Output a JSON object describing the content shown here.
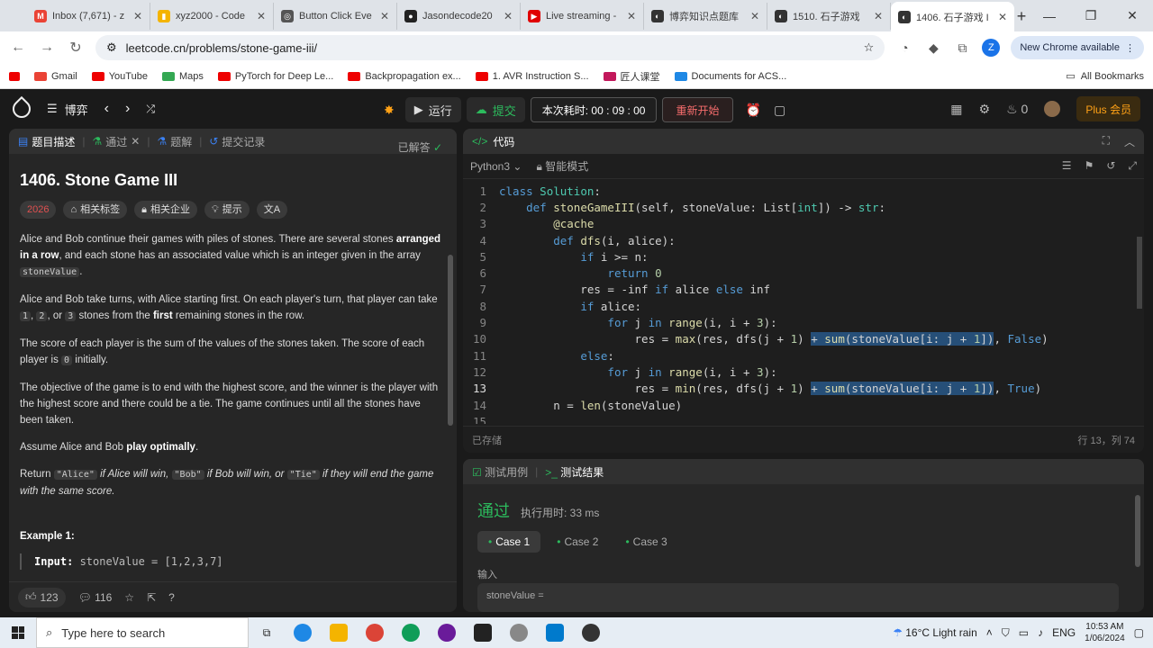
{
  "browser": {
    "tabs": [
      {
        "title": "Inbox (7,671) - z",
        "color": "#ea4335",
        "glyph": "M"
      },
      {
        "title": "xyz2000 - Code",
        "color": "#f4b400",
        "glyph": "▮"
      },
      {
        "title": "Button Click Eve",
        "color": "#555555",
        "glyph": "◎"
      },
      {
        "title": "Jasondecode20",
        "color": "#222222",
        "glyph": "●"
      },
      {
        "title": "Live streaming -",
        "color": "#e00000",
        "glyph": "▶"
      },
      {
        "title": "博弈知识点题库",
        "color": "#333333",
        "glyph": "◐"
      },
      {
        "title": "1510. 石子游戏",
        "color": "#333333",
        "glyph": "◐"
      },
      {
        "title": "1406. 石子游戏 I",
        "color": "#333333",
        "glyph": "◐"
      }
    ],
    "url": "leetcode.cn/problems/stone-game-iii/",
    "new_chrome": "New Chrome available",
    "profile_initial": "Z",
    "bookmarks": [
      "Gmail",
      "YouTube",
      "Maps",
      "PyTorch for Deep Le...",
      "Backpropagation ex...",
      "1. AVR Instruction S...",
      "匠人课堂",
      "Documents for ACS..."
    ],
    "all_bookmarks": "All Bookmarks"
  },
  "lc_header": {
    "problem_list": "博弈",
    "run": "运行",
    "submit": "提交",
    "timer": "本次耗时: 00 : 09 : 00",
    "restart": "重新开始",
    "streak": "0",
    "plus": "Plus 会员"
  },
  "left": {
    "tabs": [
      "题目描述",
      "通过",
      "题解",
      "提交记录"
    ],
    "title": "1406. Stone Game III",
    "solved": "已解答",
    "tags": [
      "2026",
      "相关标签",
      "相关企业",
      "提示",
      "文A"
    ],
    "p1_a": "Alice and Bob continue their games with piles of stones. There are several stones ",
    "p1_b": "arranged in a row",
    "p1_c": ", and each stone has an associated value which is an integer given in the array ",
    "p1_code": "stoneValue",
    "p2_a": "Alice and Bob take turns, with Alice starting first. On each player's turn, that player can take ",
    "p2_c1": "1",
    "p2_c2": "2",
    "p2_c3": "3",
    "p2_b": " stones from the ",
    "p2_first": "first",
    "p2_end": " remaining stones in the row.",
    "p3_a": "The score of each player is the sum of the values of the stones taken. The score of each player is ",
    "p3_code": "0",
    "p3_b": " initially.",
    "p4": "The objective of the game is to end with the highest score, and the winner is the player with the highest score and there could be a tie. The game continues until all the stones have been taken.",
    "p5_a": "Assume Alice and Bob ",
    "p5_b": "play optimally",
    "p6_return": "Return ",
    "p6_alice": "\"Alice\"",
    "p6_t1": " if Alice will win, ",
    "p6_bob": "\"Bob\"",
    "p6_t2": " if Bob will win, or ",
    "p6_tie": "\"Tie\"",
    "p6_t3": " if they will end the game with the same score.",
    "example_title": "Example 1:",
    "example_input_label": "Input:",
    "example_input": " stoneValue = [1,2,3,7]",
    "likes": "123",
    "comments": "116"
  },
  "code": {
    "title": "代码",
    "language": "Python3",
    "mode": "智能模式",
    "saved": "已存储",
    "cursor": "行 13，列 74",
    "lines": [
      "1",
      "2",
      "3",
      "4",
      "5",
      "6",
      "7",
      "8",
      "9",
      "10",
      "11",
      "12",
      "13",
      "14",
      "15"
    ]
  },
  "tests": {
    "tab_cases": "测试用例",
    "tab_result": "测试结果",
    "status": "通过",
    "runtime": "执行用时: 33 ms",
    "cases": [
      "Case 1",
      "Case 2",
      "Case 3"
    ],
    "input_label": "输入",
    "input_value": "stoneValue ="
  },
  "taskbar": {
    "search_placeholder": "Type here to search",
    "weather": "16°C  Light rain",
    "lang": "ENG",
    "time": "10:53 AM",
    "date": "1/06/2024"
  }
}
